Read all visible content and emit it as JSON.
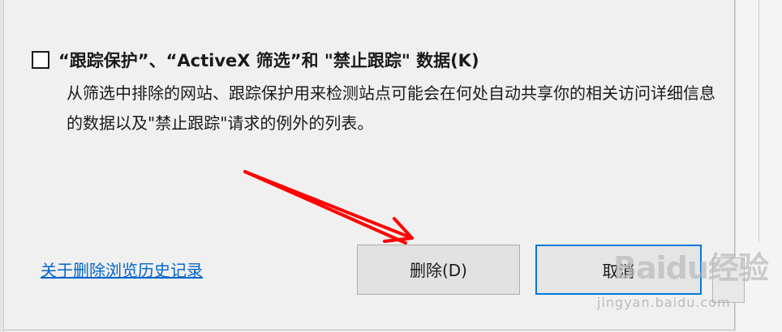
{
  "option": {
    "checked": false,
    "title": "“跟踪保护”、“ActiveX 筛选”和 \"禁止跟踪\" 数据(K)",
    "description": "从筛选中排除的网站、跟踪保护用来检测站点可能会在何处自动共享你的相关访问详细信息的数据以及\"禁止跟踪\"请求的例外的列表。"
  },
  "footer": {
    "link_label": "关于删除浏览历史记录",
    "delete_label": "删除(D)",
    "cancel_label": "取消"
  },
  "watermark": {
    "logo": "Baidu经验",
    "url": "jingyan.baidu.com"
  },
  "colors": {
    "link": "#0066cc",
    "focus_border": "#0078d7",
    "annotation_arrow": "#ff0000"
  }
}
